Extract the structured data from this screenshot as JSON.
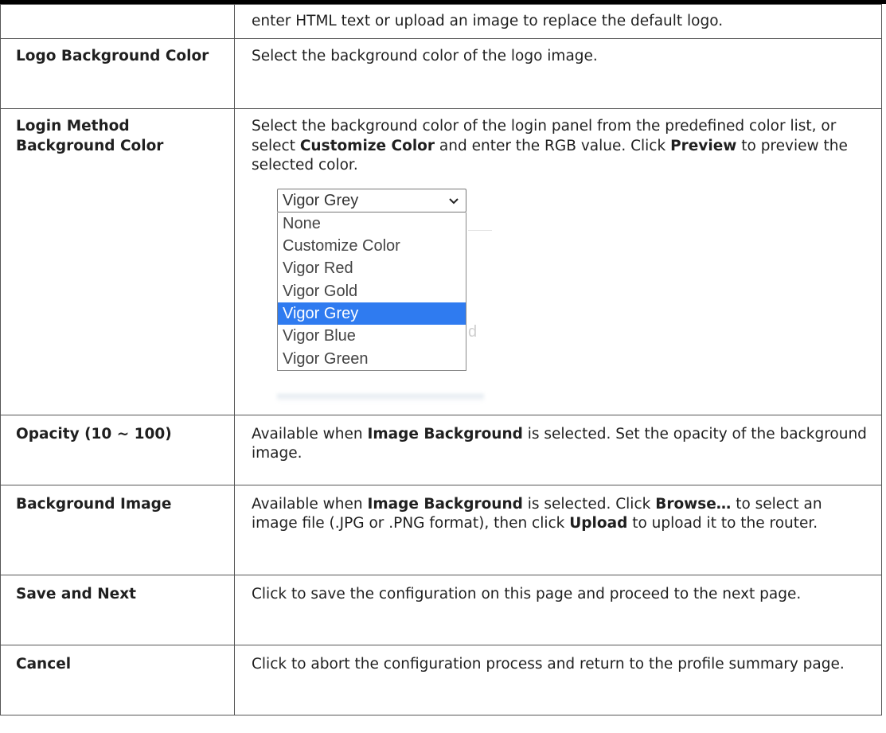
{
  "rows": [
    {
      "term": "",
      "desc": "enter HTML text or upload an image to replace the default logo."
    },
    {
      "term": "Logo Background Color",
      "desc": "Select the background color of the logo image."
    },
    {
      "term": "Login Method Background Color",
      "desc_parts": [
        "Select the background color of the login panel from the predefined color list, or select ",
        "Customize Color",
        " and enter the RGB value. Click ",
        "Preview",
        " to preview the selected color."
      ],
      "dropdown": {
        "selected_value": "Vigor Grey",
        "options": [
          "None",
          "Customize Color",
          "Vigor Red",
          "Vigor Gold",
          "Vigor Grey",
          "Vigor Blue",
          "Vigor Green"
        ],
        "highlight_color": "#2f7bf0"
      }
    },
    {
      "term": "Opacity (10 ~ 100)",
      "desc_parts": [
        "Available when ",
        "Image Background",
        " is selected. Set the opacity of the background image."
      ]
    },
    {
      "term": "Background Image",
      "desc_parts": [
        "Available when ",
        "Image Background",
        " is selected. Click ",
        "Browse…",
        " to select an image file (.JPG or .PNG format), then click ",
        "Upload",
        " to upload it to the router."
      ]
    },
    {
      "term": "Save and Next",
      "desc": "Click to save the configuration on this page and proceed to the next page."
    },
    {
      "term": "Cancel",
      "desc": "Click to abort the configuration process and return to the profile summary page."
    }
  ]
}
